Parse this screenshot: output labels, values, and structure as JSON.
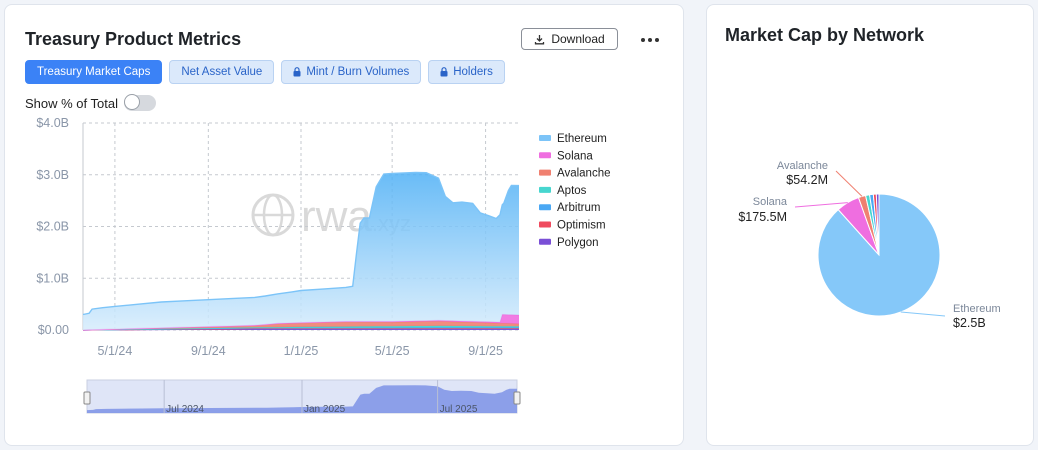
{
  "left_panel": {
    "title": "Treasury Product Metrics",
    "download_label": "Download",
    "more_icon": "more-horizontal-icon",
    "tabs": [
      {
        "label": "Treasury Market Caps",
        "active": true,
        "locked": false
      },
      {
        "label": "Net Asset Value",
        "active": false,
        "locked": false
      },
      {
        "label": "Mint / Burn Volumes",
        "active": false,
        "locked": true
      },
      {
        "label": "Holders",
        "active": false,
        "locked": true
      }
    ],
    "toggle_label": "Show % of Total",
    "toggle_on": false,
    "watermark": "rwa.xyz",
    "navigator_labels": [
      "Jul 2024",
      "Jan 2025",
      "Jul 2025"
    ]
  },
  "right_panel": {
    "title": "Market Cap by Network"
  },
  "chart_data": [
    {
      "type": "area",
      "stacked": true,
      "y_tick_labels": [
        "$0.00",
        "$1.0B",
        "$2.0B",
        "$3.0B",
        "$4.0B"
      ],
      "ylim": [
        0,
        4.0
      ],
      "y_unit": "B USD",
      "x_tick_labels": [
        "5/1/24",
        "9/1/24",
        "1/1/25",
        "5/1/25",
        "9/1/25"
      ],
      "xlim": [
        "2024-03-20",
        "2025-10-15"
      ],
      "grid": true,
      "legend_position": "right",
      "series": [
        {
          "name": "Ethereum",
          "color": "#7cc4f8",
          "points": [
            [
              "2024-03-20",
              0.3
            ],
            [
              "2024-03-28",
              0.32
            ],
            [
              "2024-04-01",
              0.4
            ],
            [
              "2024-04-15",
              0.42
            ],
            [
              "2024-05-01",
              0.44
            ],
            [
              "2024-06-01",
              0.47
            ],
            [
              "2024-07-01",
              0.5
            ],
            [
              "2024-08-01",
              0.51
            ],
            [
              "2024-09-01",
              0.52
            ],
            [
              "2024-10-01",
              0.53
            ],
            [
              "2024-11-01",
              0.54
            ],
            [
              "2024-11-15",
              0.55
            ],
            [
              "2024-12-01",
              0.57
            ],
            [
              "2024-12-20",
              0.6
            ],
            [
              "2025-01-01",
              0.62
            ],
            [
              "2025-02-01",
              0.64
            ],
            [
              "2025-03-01",
              0.66
            ],
            [
              "2025-03-10",
              0.68
            ],
            [
              "2025-03-15",
              1.3
            ],
            [
              "2025-03-20",
              1.9
            ],
            [
              "2025-03-25",
              2.0
            ],
            [
              "2025-04-01",
              2.0
            ],
            [
              "2025-04-10",
              2.6
            ],
            [
              "2025-04-20",
              2.85
            ],
            [
              "2025-05-01",
              2.86
            ],
            [
              "2025-06-01",
              2.87
            ],
            [
              "2025-06-15",
              2.86
            ],
            [
              "2025-07-01",
              2.75
            ],
            [
              "2025-07-10",
              2.4
            ],
            [
              "2025-07-20",
              2.28
            ],
            [
              "2025-08-01",
              2.3
            ],
            [
              "2025-08-15",
              2.28
            ],
            [
              "2025-08-25",
              2.1
            ],
            [
              "2025-09-05",
              2.05
            ],
            [
              "2025-09-15",
              2.0
            ],
            [
              "2025-09-25",
              2.15
            ],
            [
              "2025-10-01",
              2.4
            ],
            [
              "2025-10-05",
              2.5
            ],
            [
              "2025-10-15",
              2.5
            ]
          ]
        },
        {
          "name": "Solana",
          "color": "#ef6ee0",
          "points": [
            [
              "2024-03-20",
              0
            ],
            [
              "2024-11-01",
              0
            ],
            [
              "2025-09-20",
              0.02
            ],
            [
              "2025-09-23",
              0.17
            ],
            [
              "2025-10-15",
              0.17
            ]
          ]
        },
        {
          "name": "Avalanche",
          "color": "#f08070",
          "points": [
            [
              "2024-03-20",
              0
            ],
            [
              "2024-11-01",
              0.04
            ],
            [
              "2024-12-01",
              0.07
            ],
            [
              "2025-01-01",
              0.08
            ],
            [
              "2025-03-01",
              0.09
            ],
            [
              "2025-05-01",
              0.08
            ],
            [
              "2025-07-01",
              0.09
            ],
            [
              "2025-10-15",
              0.05
            ]
          ]
        },
        {
          "name": "Aptos",
          "color": "#47d6cf",
          "points": [
            [
              "2024-03-20",
              0
            ],
            [
              "2024-11-01",
              0.01
            ],
            [
              "2025-01-01",
              0.02
            ],
            [
              "2025-07-01",
              0.03
            ],
            [
              "2025-10-15",
              0.02
            ]
          ]
        },
        {
          "name": "Arbitrum",
          "color": "#4aa8f4",
          "points": [
            [
              "2024-03-20",
              0
            ],
            [
              "2024-11-01",
              0.01
            ],
            [
              "2025-01-01",
              0.01
            ],
            [
              "2025-07-01",
              0.02
            ],
            [
              "2025-10-15",
              0.02
            ]
          ]
        },
        {
          "name": "Optimism",
          "color": "#ef4a5e",
          "points": [
            [
              "2024-03-20",
              0
            ],
            [
              "2024-11-01",
              0.01
            ],
            [
              "2025-01-01",
              0.01
            ],
            [
              "2025-10-15",
              0.01
            ]
          ]
        },
        {
          "name": "Polygon",
          "color": "#7a4fd6",
          "points": [
            [
              "2024-03-20",
              0
            ],
            [
              "2024-11-01",
              0.02
            ],
            [
              "2025-01-01",
              0.02
            ],
            [
              "2025-10-15",
              0.02
            ]
          ]
        }
      ]
    },
    {
      "type": "pie",
      "slices": [
        {
          "name": "Ethereum",
          "label": "Ethereum",
          "value_label": "$2.5B",
          "value": 2500,
          "color": "#85c8f9"
        },
        {
          "name": "Solana",
          "label": "Solana",
          "value_label": "$175.5M",
          "value": 175.5,
          "color": "#ef6ee0"
        },
        {
          "name": "Avalanche",
          "label": "Avalanche",
          "value_label": "$54.2M",
          "value": 54.2,
          "color": "#f08070"
        },
        {
          "name": "Aptos",
          "label": "",
          "value_label": "",
          "value": 30,
          "color": "#47d6cf"
        },
        {
          "name": "Arbitrum",
          "label": "",
          "value_label": "",
          "value": 28,
          "color": "#4aa8f4"
        },
        {
          "name": "Optimism",
          "label": "",
          "value_label": "",
          "value": 22,
          "color": "#ef4a5e"
        },
        {
          "name": "Polygon",
          "label": "",
          "value_label": "",
          "value": 20,
          "color": "#7a4fd6"
        }
      ]
    }
  ]
}
